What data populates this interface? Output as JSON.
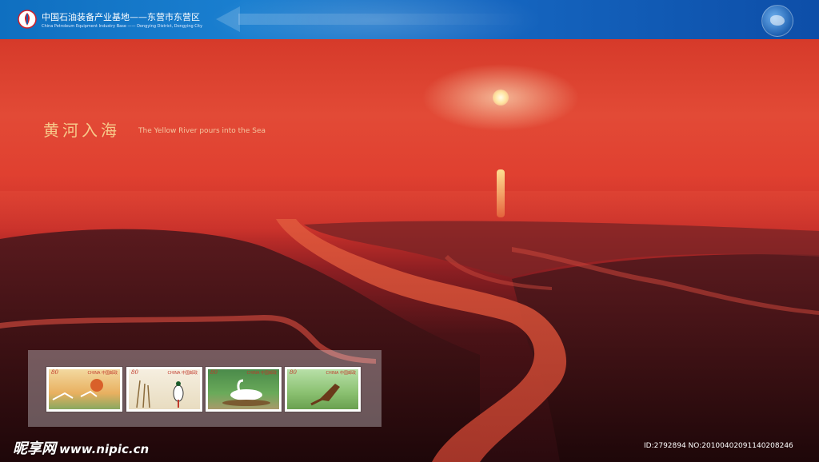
{
  "header": {
    "brand_cn": "中国石油装备产业基地——东营市东营区",
    "brand_en": "China Petroleum Equipment Industry Base —— Dongying District, Dongying City",
    "logo_icon": "petroleum-logo-icon",
    "globe_icon": "globe-icon",
    "colors": {
      "bar": "#1a7fd0"
    }
  },
  "scene": {
    "title_cn": "黄河入海",
    "title_en": "The Yellow River pours into the Sea",
    "colors": {
      "sky": "#e24a36",
      "delta": "#2a0a0e",
      "title": "#f7c98a"
    }
  },
  "stamps": [
    {
      "value": "80",
      "country": "CHINA 中国邮政"
    },
    {
      "value": "80",
      "country": "CHINA 中国邮政"
    },
    {
      "value": "80",
      "country": "CHINA 中国邮政"
    },
    {
      "value": "80",
      "country": "CHINA 中国邮政"
    }
  ],
  "footer": {
    "site_cn": "昵享网",
    "site_url": "www.nipic.cn",
    "id_line": "ID:2792894 NO:20100402091140208246"
  }
}
